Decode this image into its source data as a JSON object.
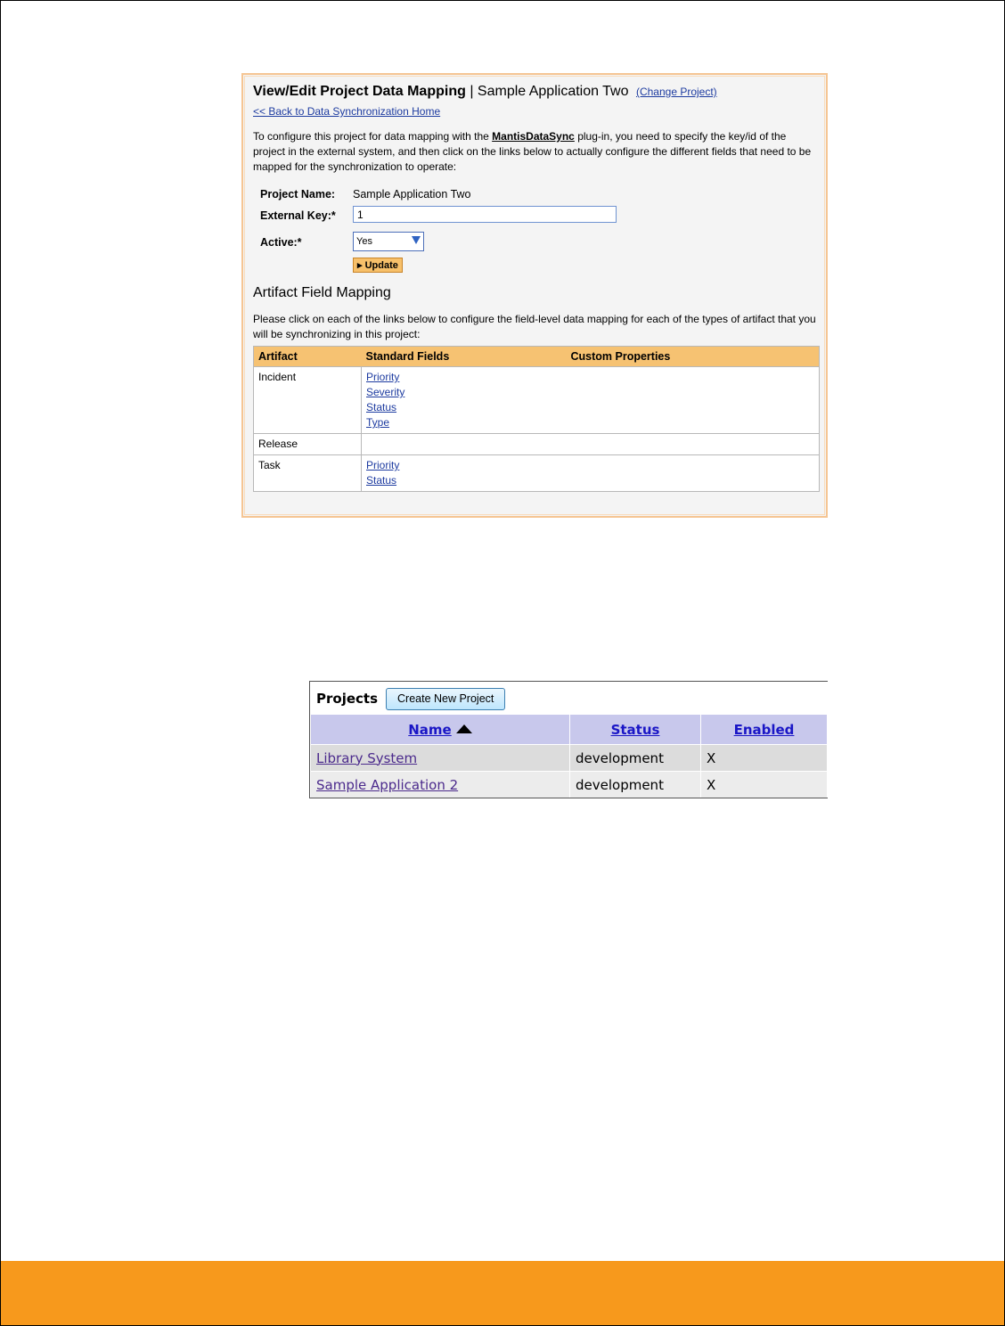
{
  "mapping": {
    "title": "View/Edit Project Data Mapping",
    "separator": "|",
    "project_title": "Sample Application Two",
    "change_project": "(Change Project)",
    "back_link": "<< Back to Data Synchronization Home",
    "intro_before": "To configure this project for data mapping with the ",
    "plugin_name": "MantisDataSync",
    "intro_after": " plug-in, you need to specify the key/id of the project in the external system, and then click on the links below to actually configure the different fields that need to be mapped for the synchronization to operate:",
    "form": {
      "project_name_label": "Project Name:",
      "project_name_value": "Sample Application Two",
      "external_key_label": "External Key:*",
      "external_key_value": "1",
      "active_label": "Active:*",
      "active_value": "Yes",
      "update_button": "▸ Update"
    },
    "artifact_heading": "Artifact Field Mapping",
    "artifact_text": "Please click on each of the links below to configure the field-level data mapping for each of the types of artifact that you will be synchronizing in this project:",
    "table_headers": [
      "Artifact",
      "Standard Fields",
      "Custom Properties"
    ],
    "rows": [
      {
        "artifact": "Incident",
        "fields": [
          "Priority",
          "Severity",
          "Status",
          "Type"
        ]
      },
      {
        "artifact": "Release",
        "fields": []
      },
      {
        "artifact": "Task",
        "fields": [
          "Priority",
          "Status"
        ]
      }
    ]
  },
  "projects": {
    "title": "Projects",
    "create_button": "Create New Project",
    "headers": [
      "Name",
      "Status",
      "Enabled"
    ],
    "rows": [
      {
        "name": "Library System",
        "status": "development",
        "enabled": "X"
      },
      {
        "name": "Sample Application 2",
        "status": "development",
        "enabled": "X"
      }
    ]
  },
  "colors": {
    "footer": "#f7991c",
    "panel_border": "#f5c593",
    "table_header": "#f6c272",
    "projects_header": "#c8c8ec"
  }
}
